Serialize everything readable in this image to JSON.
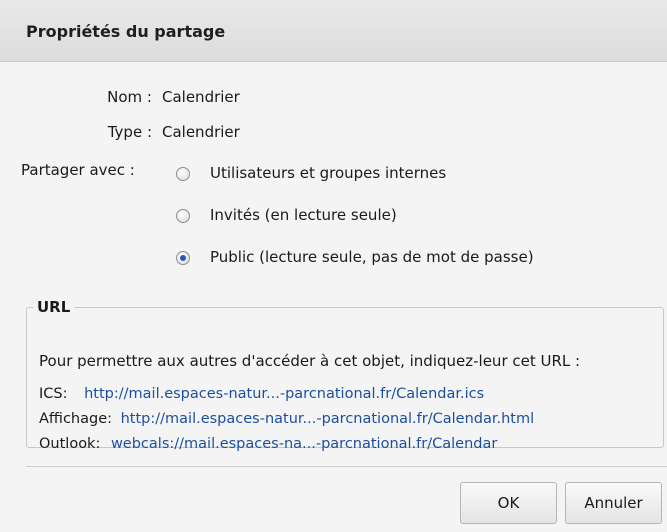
{
  "dialog": {
    "title": "Propriétés du partage",
    "fields": {
      "name_label": "Nom :",
      "name_value": "Calendrier",
      "type_label": "Type :",
      "type_value": "Calendrier"
    },
    "share": {
      "label": "Partager avec :",
      "options": [
        {
          "label": "Utilisateurs et groupes internes",
          "checked": false
        },
        {
          "label": "Invités (en lecture seule)",
          "checked": false
        },
        {
          "label": "Public (lecture seule, pas de mot de passe)",
          "checked": true
        }
      ]
    },
    "url": {
      "legend": "URL",
      "intro": "Pour permettre aux autres d'accéder à cet objet, indiquez-leur cet URL :",
      "rows": [
        {
          "key": "ICS:",
          "link": "http://mail.espaces-natur...-parcnational.fr/Calendar.ics"
        },
        {
          "key": "Affichage:",
          "link": "http://mail.espaces-natur...-parcnational.fr/Calendar.html"
        },
        {
          "key": "Outlook:",
          "link": "webcals://mail.espaces-na...-parcnational.fr/Calendar"
        }
      ]
    },
    "buttons": {
      "ok": "OK",
      "cancel": "Annuler"
    }
  }
}
